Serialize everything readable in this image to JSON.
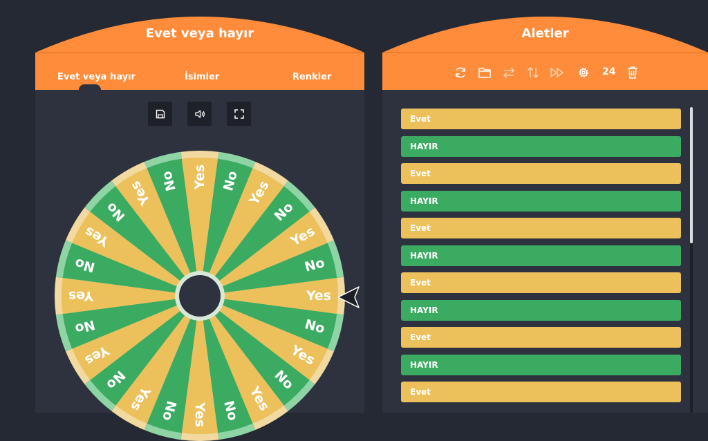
{
  "left_panel": {
    "title": "Evet veya hayır",
    "tabs": [
      "Evet veya hayır",
      "İsimler",
      "Renkler"
    ],
    "controls": [
      "save-icon",
      "volume-icon",
      "fullscreen-icon"
    ]
  },
  "wheel": {
    "segments": [
      "Yes",
      "No",
      "Yes",
      "No",
      "Yes",
      "No",
      "Yes",
      "No",
      "Yes",
      "No",
      "Yes",
      "No",
      "Yes",
      "No",
      "Yes",
      "No",
      "Yes",
      "No",
      "Yes",
      "No",
      "Yes",
      "No",
      "Yes",
      "No"
    ],
    "colors": {
      "yes": "#ecc15c",
      "no": "#3aab61",
      "rim_yes": "#f2d9a0",
      "rim_no": "#8fd4a5",
      "hub": "#2d323e"
    }
  },
  "right_panel": {
    "title": "Aletler",
    "tools": [
      "refresh-icon",
      "folder-icon",
      "swap-icon",
      "sort-icon",
      "fast-forward-icon",
      "settings-icon"
    ],
    "count": "24",
    "trash": "trash-icon",
    "items": [
      {
        "label": "Evet",
        "color": "#ecc15c"
      },
      {
        "label": "HAYIR",
        "color": "#3aab61"
      },
      {
        "label": "Evet",
        "color": "#ecc15c"
      },
      {
        "label": "HAYIR",
        "color": "#3aab61"
      },
      {
        "label": "Evet",
        "color": "#ecc15c"
      },
      {
        "label": "HAYIR",
        "color": "#3aab61"
      },
      {
        "label": "Evet",
        "color": "#ecc15c"
      },
      {
        "label": "HAYIR",
        "color": "#3aab61"
      },
      {
        "label": "Evet",
        "color": "#ecc15c"
      },
      {
        "label": "HAYIR",
        "color": "#3aab61"
      },
      {
        "label": "Evet",
        "color": "#ecc15c"
      }
    ]
  },
  "theme": {
    "accent": "#ff8c3a",
    "background": "#252933",
    "panel": "#2d323e"
  }
}
